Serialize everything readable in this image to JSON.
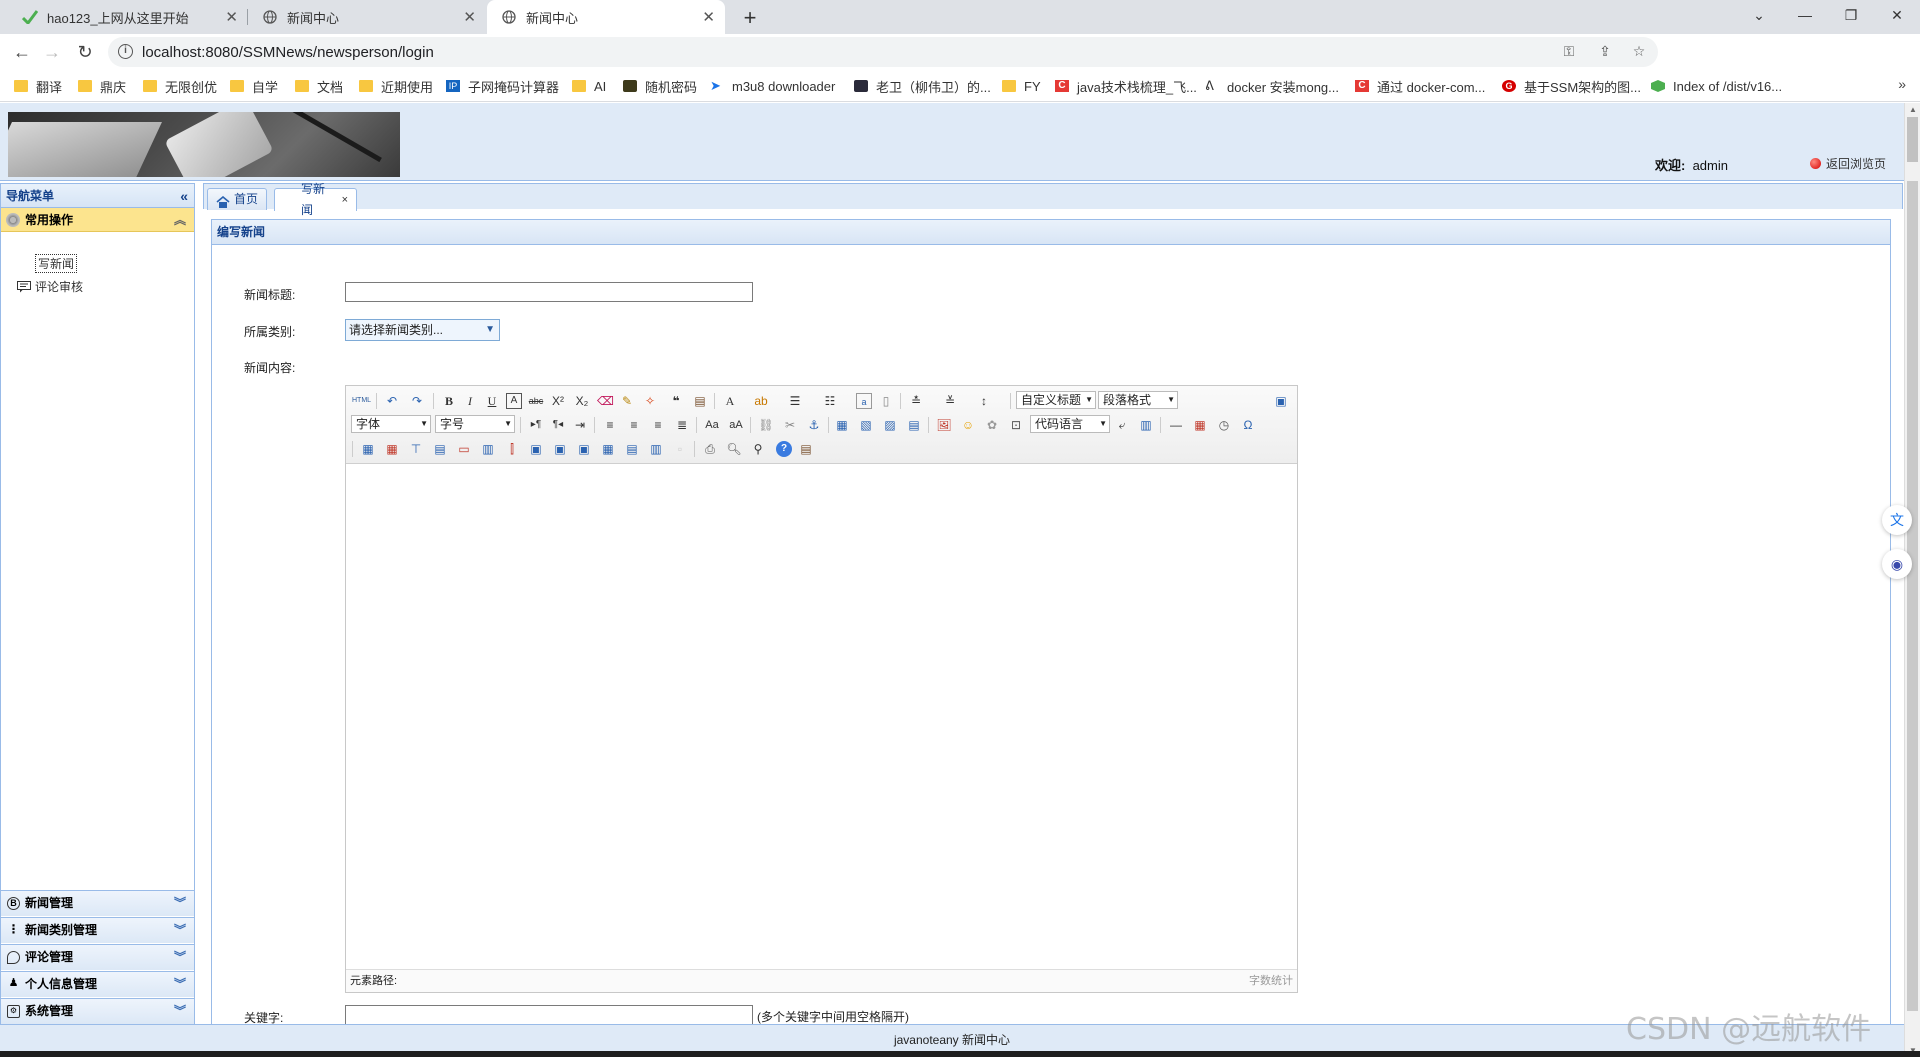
{
  "browser": {
    "tabs": [
      {
        "title": "hao123_上网从这里开始",
        "active": false
      },
      {
        "title": "新闻中心",
        "active": false
      },
      {
        "title": "新闻中心",
        "active": true
      }
    ],
    "url": "localhost:8080/SSMNews/newsperson/login",
    "bookmarks": [
      "翻译",
      "鼎庆",
      "无限创优",
      "自学",
      "文档",
      "近期使用",
      "子网掩码计算器",
      "AI",
      "随机密码",
      "m3u8 downloader",
      "老卫（柳伟卫）的...",
      "FY",
      "java技术栈梳理_飞...",
      "docker 安装mong...",
      "通过 docker-com...",
      "基于SSM架构的图...",
      "Index of /dist/v16..."
    ],
    "colors": {
      "tabbar": "#dee1e6",
      "folder": "#f8c740"
    }
  },
  "header": {
    "welcome_label": "欢迎:",
    "username": "admin",
    "back_link": "返回浏览页"
  },
  "sidebar": {
    "title": "导航菜单",
    "open_group": "常用操作",
    "items": [
      "写新闻",
      "评论审核"
    ],
    "groups": [
      "新闻管理",
      "新闻类别管理",
      "评论管理",
      "个人信息管理",
      "系统管理"
    ]
  },
  "main": {
    "tabs": [
      "首页",
      "写新闻"
    ],
    "panel_title": "编写新闻",
    "form": {
      "title_label": "新闻标题:",
      "title_value": "",
      "category_label": "所属类别:",
      "category_selected": "请选择新闻类别...",
      "content_label": "新闻内容:",
      "keywords_label": "关键字:",
      "keywords_value": "",
      "keywords_hint": "(多个关键字中间用空格隔开)"
    },
    "editor": {
      "font_select": "字体",
      "size_select": "字号",
      "heading_select": "自定义标题",
      "paragraph_select": "段落格式",
      "code_select": "代码语言",
      "path_label": "元素路径:",
      "word_count": "字数统计"
    }
  },
  "footer": {
    "text": "javanoteany 新闻中心"
  },
  "watermark": "CSDN @远航软件",
  "accent_color": "#99bbe8"
}
